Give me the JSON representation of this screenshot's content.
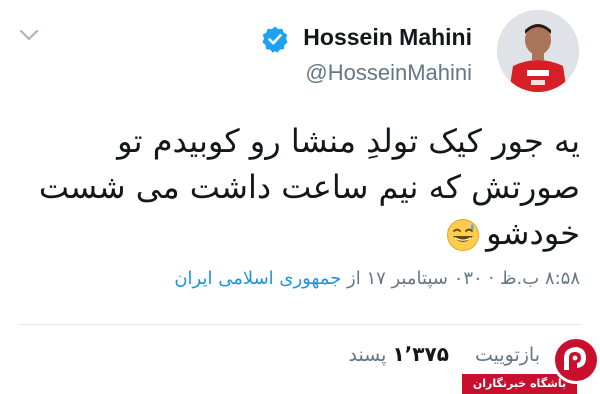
{
  "user": {
    "display_name": "Hossein Mahini",
    "handle": "@HosseinMahini",
    "verified_icon": "verified-badge-icon",
    "verified_color": "#1da1f2"
  },
  "tweet": {
    "lines": [
      "یه جور کیک تولدِ منشا رو کوبیدم تو",
      "صورتش که نیم ساعت داشت می شست",
      "خودشو"
    ],
    "emoji": "grinning-sweat-emoji"
  },
  "meta": {
    "timestamp": "۸:۵۸ ب.ظ · ۰۳۰ سپتامبر ۱۷ از",
    "location": "جمهوری اسلامی ایران"
  },
  "stats": {
    "retweets_label": "بازتوییت",
    "likes_count": "۱٬۳۷۵",
    "likes_label": "پسند"
  },
  "watermark": {
    "text": "باشگاه خبرنگاران"
  },
  "colors": {
    "link": "#1b95e0",
    "secondary_text": "#657786",
    "primary_text": "#14171a",
    "watermark_red": "#c8102e"
  }
}
